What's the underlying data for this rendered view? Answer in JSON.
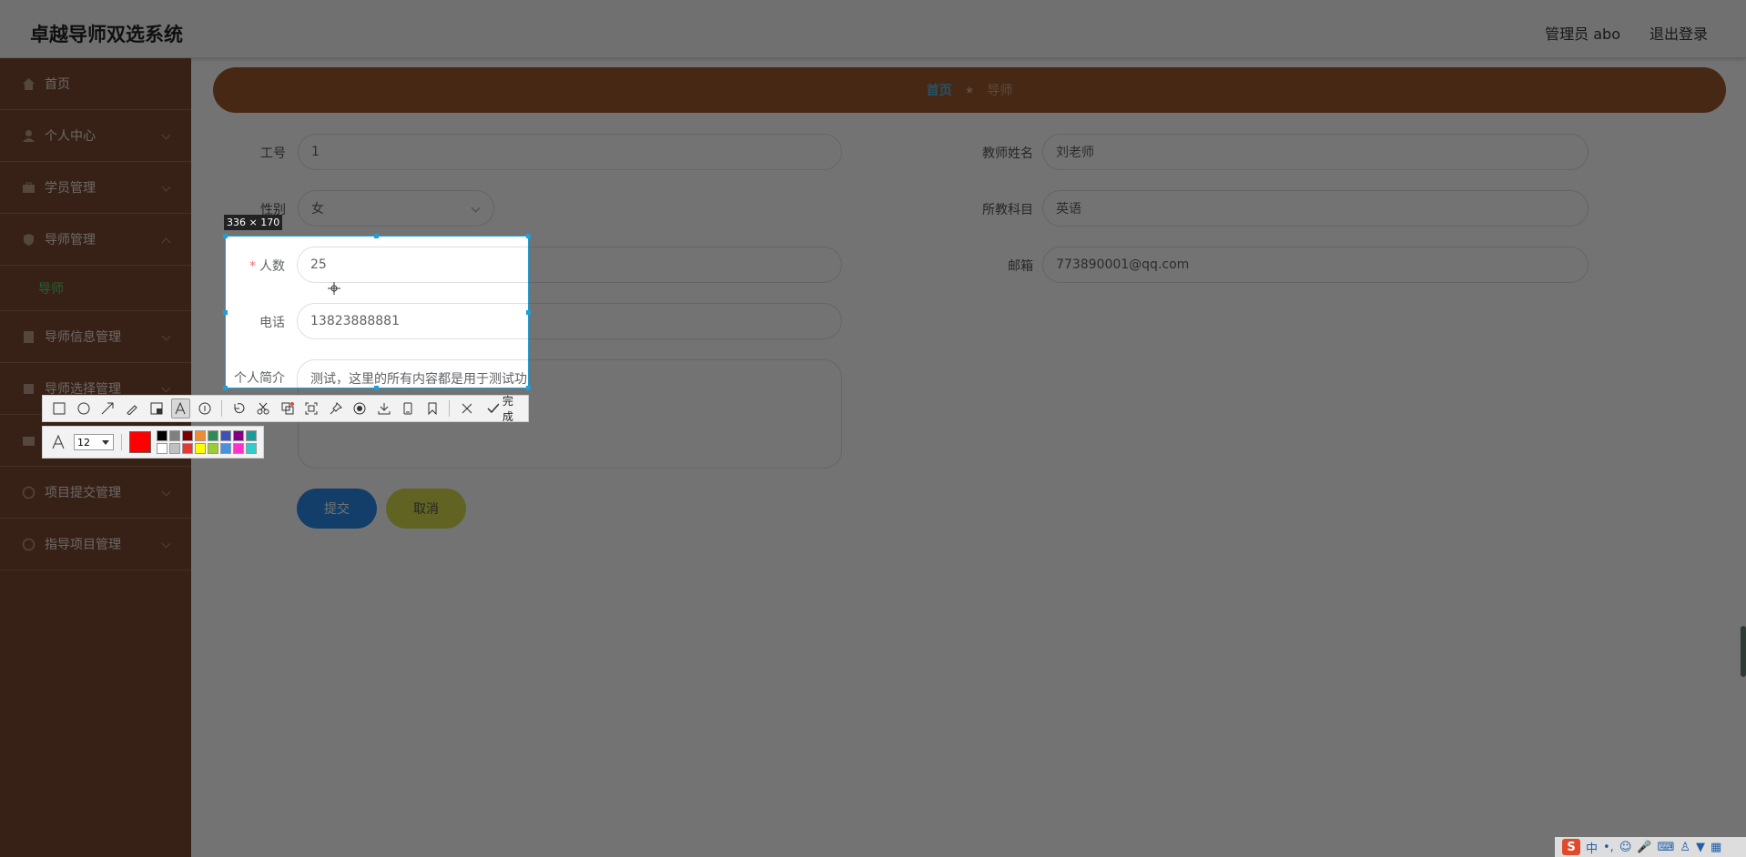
{
  "header": {
    "title": "卓越导师双选系统",
    "user": "管理员 abo",
    "logout": "退出登录"
  },
  "sidebar": {
    "items": [
      {
        "label": "首页"
      },
      {
        "label": "个人中心"
      },
      {
        "label": "学员管理"
      },
      {
        "label": "导师管理"
      },
      {
        "label": "导师信息管理"
      },
      {
        "label": "导师选择管理"
      },
      {
        "label": ""
      },
      {
        "label": "项目提交管理"
      },
      {
        "label": "指导项目管理"
      }
    ],
    "sub_item": "导师"
  },
  "breadcrumb": {
    "home": "首页",
    "sep": "★",
    "current": "导师"
  },
  "form": {
    "job_no_label": "工号",
    "job_no": "1",
    "teacher_name_label": "教师姓名",
    "teacher_name": "刘老师",
    "gender_label": "性别",
    "gender": "女",
    "subject_label": "所教科目",
    "subject": "英语",
    "count_label": "人数",
    "count": "25",
    "email_label": "邮箱",
    "email": "773890001@qq.com",
    "phone_label": "电话",
    "phone": "13823888881",
    "bio_label": "个人简介",
    "bio": "测试，这里的所有内容都是用于测试功能的， 都是可以自行添加修改删除、替换的",
    "submit": "提交",
    "cancel": "取消"
  },
  "screenshot_tool": {
    "size": "336 × 170",
    "done": "完成",
    "font_size": "12",
    "current_color": "#ff0000",
    "swatches": [
      "#000000",
      "#808080",
      "#800000",
      "#f28b30",
      "#2e8b57",
      "#3f51b5",
      "#800080",
      "#1a9a9a",
      "#ffffff",
      "#c0c0c0",
      "#e53935",
      "#ffff00",
      "#9acd32",
      "#4a90e2",
      "#ff33cc",
      "#33cccc"
    ]
  },
  "tray": {
    "ime": "中"
  }
}
